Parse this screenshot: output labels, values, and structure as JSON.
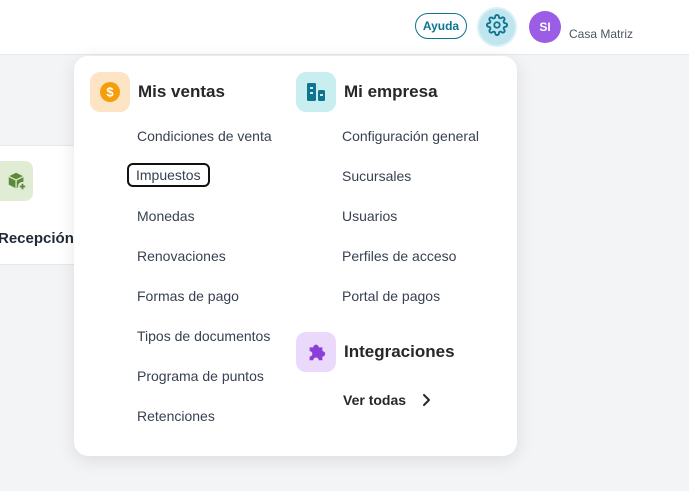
{
  "header": {
    "help_label": "Ayuda",
    "settings_icon": "gear-icon",
    "avatar_initials": "SI",
    "company_name": "Casa Matriz"
  },
  "background": {
    "card_label": "Recepción",
    "card_icon": "box-add-icon"
  },
  "menu": {
    "sales": {
      "title": "Mis ventas",
      "icon": "dollar-icon",
      "items": [
        "Condiciones de venta",
        "Impuestos",
        "Monedas",
        "Renovaciones",
        "Formas de pago",
        "Tipos de documentos",
        "Programa de puntos",
        "Retenciones"
      ],
      "focused_item": "Impuestos"
    },
    "company": {
      "title": "Mi empresa",
      "icon": "building-icon",
      "items": [
        "Configuración general",
        "Sucursales",
        "Usuarios",
        "Perfiles de acceso",
        "Portal de pagos"
      ]
    },
    "integrations": {
      "title": "Integraciones",
      "icon": "puzzle-icon",
      "see_all_label": "Ver todas"
    }
  },
  "colors": {
    "accent": "#0e7490",
    "avatar": "#9b5de5",
    "sales_icon_bg": "#fde4c4",
    "sales_icon_fg": "#f59e0b",
    "company_icon_bg": "#c9eef0",
    "company_icon_fg": "#0e7490",
    "integrations_icon_bg": "#ebd9fb",
    "integrations_icon_fg": "#8b3fd9"
  }
}
